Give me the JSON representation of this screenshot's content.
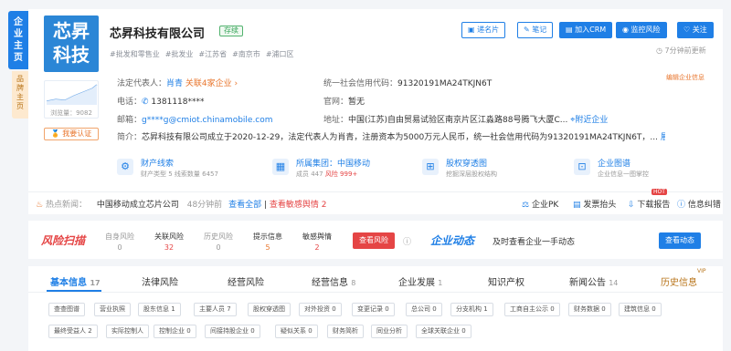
{
  "side": {
    "main": "企业主页",
    "brand": "品牌主页"
  },
  "logo": {
    "line1": "芯昇",
    "line2": "科技",
    "views": "浏览量：9082",
    "cert": "我要认证"
  },
  "company": {
    "name": "芯昇科技有限公司",
    "status": "存续"
  },
  "tags": [
    "#批发和零售业",
    "#批发业",
    "#江苏省",
    "#南京市",
    "#浦口区"
  ],
  "buttons": {
    "card": "递名片",
    "note": "笔记",
    "crm": "加入CRM",
    "monitor": "监控风险",
    "follow": "关注"
  },
  "update": "7分钟前更新",
  "legal": {
    "label": "法定代表人：",
    "name": "肖青",
    "rel": "关联4家企业 ›",
    "credit_label": "统一社会信用代码：",
    "credit": "91320191MA24TKJN6T",
    "edit": "编辑企业信息"
  },
  "phone": {
    "label": "电话：",
    "value": "1381118****",
    "site_label": "官网：",
    "site": "暂无"
  },
  "email": {
    "label": "邮箱：",
    "value": "g****g@cmiot.chinamobile.com",
    "addr_label": "地址：",
    "addr": "中国(江苏)自由贸易试验区南京片区江淼路88号腾飞大厦C...",
    "nearby": "附近企业"
  },
  "intro": {
    "label": "简介：",
    "text": "芯昇科技有限公司成立于2020-12-29，法定代表人为肖青，注册资本为5000万元人民币，统一社会信用代码为91320191MA24TKJN6T，...",
    "more": "展开"
  },
  "features": [
    {
      "title": "财产线索",
      "sub1": "财产类型 5",
      "sub2": "线索数量 6457",
      "icon": "clue-icon"
    },
    {
      "title": "所属集团：中国移动",
      "sub1": "成员 447",
      "sub2": "风险 999+",
      "icon": "group-icon"
    },
    {
      "title": "股权穿透图",
      "sub1": "挖掘深层股权结构",
      "sub2": "",
      "icon": "equity-icon"
    },
    {
      "title": "企业图谱",
      "sub1": "企业信息一图掌控",
      "sub2": "",
      "icon": "graph-icon"
    }
  ],
  "news": {
    "label": "热点新闻：",
    "text": "中国移动成立芯片公司",
    "time": "48分钟前",
    "all": "查看全部",
    "sensitive": "查看敏感舆情 2",
    "pk": "企业PK",
    "invoice": "发票抬头",
    "download": "下载报告",
    "hot": "HOT",
    "report": "信息纠错"
  },
  "risk": {
    "logo": "风险扫描",
    "cols": [
      {
        "label": "自身风险",
        "value": "0"
      },
      {
        "label": "关联风险",
        "value": "32"
      },
      {
        "label": "历史风险",
        "value": "0"
      },
      {
        "label": "提示信息",
        "value": "5"
      },
      {
        "label": "敏感舆情",
        "value": "2"
      }
    ],
    "btn": "查看风险",
    "dyn_logo": "企业动态",
    "dyn_text": "及时查看企业一手动态",
    "dyn_btn": "查看动态"
  },
  "tabs": [
    {
      "label": "基本信息",
      "count": "17"
    },
    {
      "label": "法律风险",
      "count": ""
    },
    {
      "label": "经营风险",
      "count": ""
    },
    {
      "label": "经营信息",
      "count": "8"
    },
    {
      "label": "企业发展",
      "count": "1"
    },
    {
      "label": "知识产权",
      "count": ""
    },
    {
      "label": "新闻公告",
      "count": "14"
    },
    {
      "label": "历史信息",
      "count": ""
    }
  ],
  "vip": "VIP",
  "chips_row1": [
    "查查图谱",
    "营业执照",
    "股东信息 1",
    "主要人员 7",
    "股权穿透图",
    "对外投资 0",
    "变更记录 0",
    "总公司 0",
    "分支机构 1",
    "工商自主公示 0",
    "财务数据 0",
    "建筑信息 0"
  ],
  "chips_row2": [
    "最终受益人 2",
    "实际控制人",
    "控制企业 0",
    "间接持股企业 0",
    "疑似关系 0",
    "财务简析",
    "同业分析",
    "全球关联企业 0"
  ]
}
